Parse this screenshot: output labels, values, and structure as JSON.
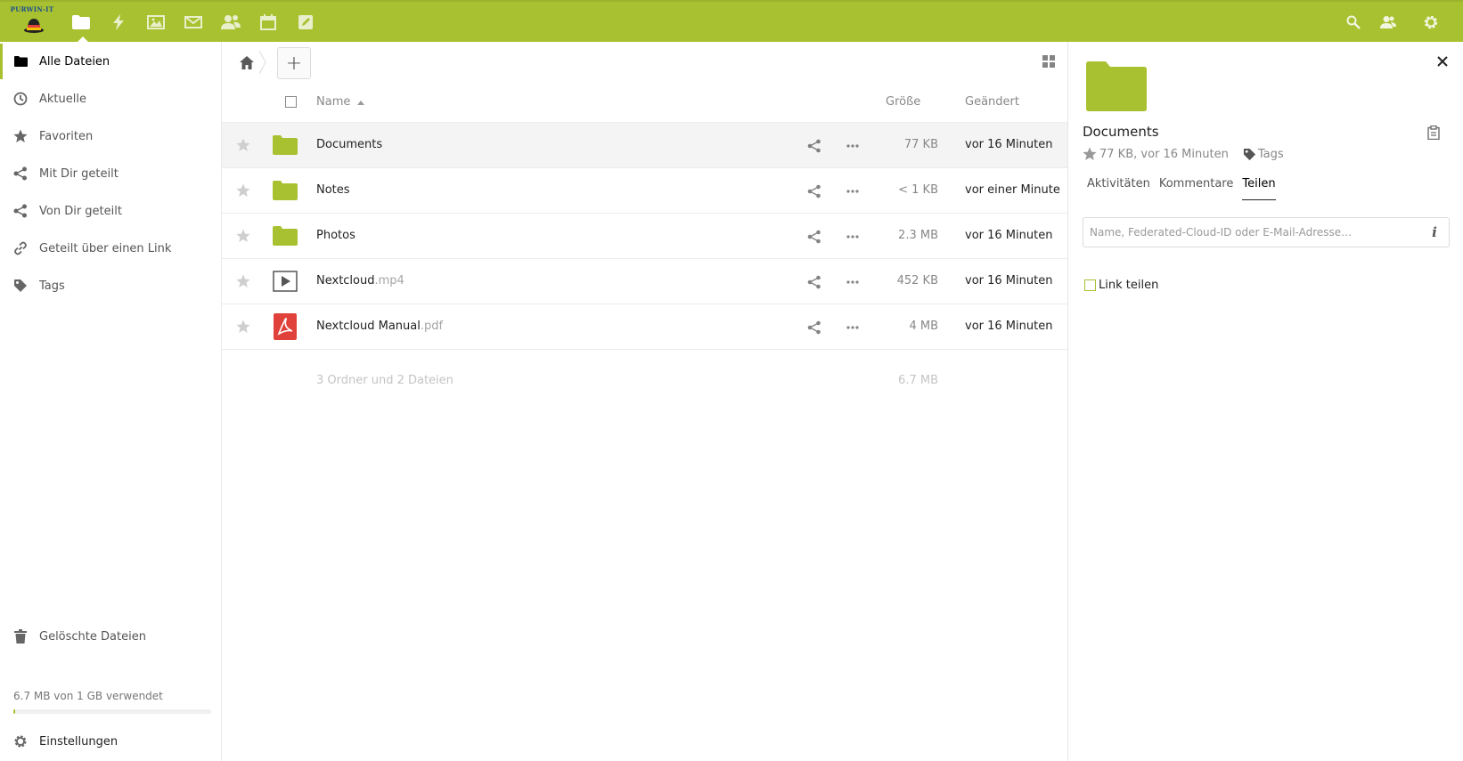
{
  "logo": {
    "text": "PURWIN-IT"
  },
  "header": {
    "apps": [
      {
        "name": "files",
        "icon": "folder-icon",
        "active": true
      },
      {
        "name": "activity",
        "icon": "lightning-icon",
        "active": false
      },
      {
        "name": "gallery",
        "icon": "image-icon",
        "active": false
      },
      {
        "name": "mail",
        "icon": "mail-icon",
        "active": false
      },
      {
        "name": "contacts",
        "icon": "contacts-icon",
        "active": false
      },
      {
        "name": "calendar",
        "icon": "calendar-icon",
        "active": false
      },
      {
        "name": "notes",
        "icon": "edit-icon",
        "active": false
      }
    ],
    "right_icons": [
      "search-icon",
      "contacts-menu-icon",
      "settings-icon"
    ]
  },
  "sidebar": {
    "items": [
      {
        "label": "Alle Dateien",
        "icon": "folder-icon",
        "active": true
      },
      {
        "label": "Aktuelle",
        "icon": "clock-icon"
      },
      {
        "label": "Favoriten",
        "icon": "star-icon"
      },
      {
        "label": "Mit Dir geteilt",
        "icon": "share-icon"
      },
      {
        "label": "Von Dir geteilt",
        "icon": "share-icon"
      },
      {
        "label": "Geteilt über einen Link",
        "icon": "link-icon"
      },
      {
        "label": "Tags",
        "icon": "tag-icon"
      }
    ],
    "trash_label": "Gelöschte Dateien",
    "quota_text": "6.7 MB von 1 GB verwendet",
    "quota_percent": 0.7,
    "settings_label": "Einstellungen"
  },
  "toolbar": {
    "new_label": "+"
  },
  "file_list": {
    "columns": {
      "name": "Name",
      "size": "Größe",
      "modified": "Geändert"
    },
    "rows": [
      {
        "base": "Documents",
        "ext": "",
        "type": "folder",
        "size": "77 KB",
        "modified": "vor 16 Minuten",
        "selected": true
      },
      {
        "base": "Notes",
        "ext": "",
        "type": "folder",
        "size": "< 1 KB",
        "modified": "vor einer Minute"
      },
      {
        "base": "Photos",
        "ext": "",
        "type": "folder",
        "size": "2.3 MB",
        "modified": "vor 16 Minuten"
      },
      {
        "base": "Nextcloud",
        "ext": ".mp4",
        "type": "video",
        "size": "452 KB",
        "modified": "vor 16 Minuten"
      },
      {
        "base": "Nextcloud Manual",
        "ext": ".pdf",
        "type": "pdf",
        "size": "4 MB",
        "modified": "vor 16 Minuten"
      }
    ],
    "summary_count": "3 Ordner und 2 Dateien",
    "summary_size": "6.7 MB"
  },
  "details": {
    "title": "Documents",
    "meta": "77 KB, vor 16 Minuten",
    "tags_label": "Tags",
    "tabs": [
      {
        "label": "Aktivitäten"
      },
      {
        "label": "Kommentare"
      },
      {
        "label": "Teilen",
        "active": true
      }
    ],
    "share_placeholder": "Name, Federated-Cloud-ID oder E-Mail-Adresse…",
    "info_label": "i",
    "link_share_label": "Link teilen"
  },
  "colors": {
    "accent": "#a8c130",
    "folder": "#a8c130",
    "pdf": "#e0413a"
  }
}
